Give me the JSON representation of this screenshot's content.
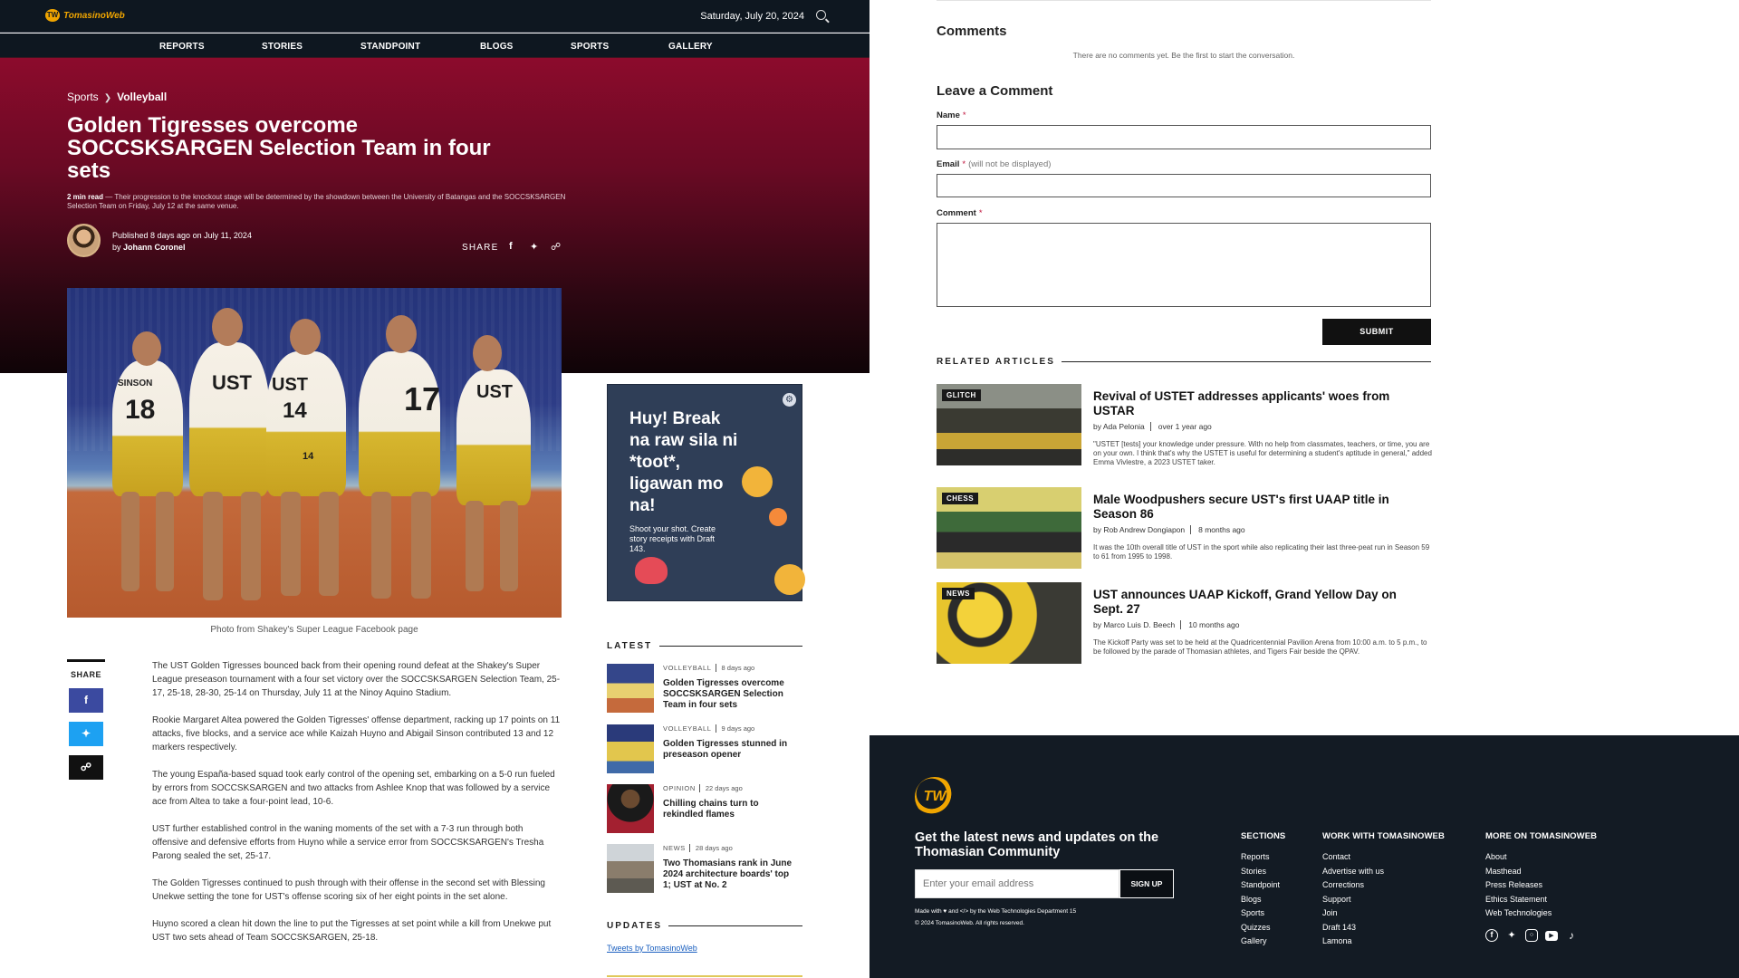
{
  "header": {
    "logo_text": "TomasinoWeb",
    "logo_mark": "TW",
    "date": "Saturday, July 20, 2024"
  },
  "nav": [
    "REPORTS",
    "STORIES",
    "STANDPOINT",
    "BLOGS",
    "SPORTS",
    "GALLERY"
  ],
  "article": {
    "breadcrumb": [
      "Sports",
      "Volleyball"
    ],
    "title": "Golden Tigresses overcome SOCCSKSARGEN Selection Team in four sets",
    "read_time": "2 min read",
    "dek": "— Their progression to the knockout stage will be determined by the showdown between the University of Batangas and the SOCCSKSARGEN Selection Team on Friday, July 12 at the same venue.",
    "published": "Published 8 days ago on July 11, 2024",
    "by": "by",
    "author": "Johann Coronel",
    "share_label": "SHARE",
    "photo_caption": "Photo from Shakey's Super League Facebook page",
    "jersey_numbers": [
      "18",
      "14",
      "17",
      "14"
    ],
    "jersey_text": [
      "SINSON",
      "UST",
      "UST",
      "UST"
    ],
    "paragraphs": [
      "The UST Golden Tigresses bounced back from their opening round defeat at the Shakey's Super League preseason tournament with a four set victory over the SOCCSKSARGEN Selection Team, 25-17, 25-18, 28-30, 25-14 on Thursday, July 11 at the Ninoy Aquino Stadium.",
      "Rookie Margaret Altea powered the Golden Tigresses' offense department, racking up 17 points on 11 attacks, five blocks, and a service ace while Kaizah Huyno and Abigail Sinson contributed 13 and 12 markers respectively.",
      "The young España-based squad took early control of the opening set, embarking on a 5-0 run fueled by errors from SOCCSKSARGEN and two attacks from Ashlee Knop that was followed by a service ace from Altea to take a four-point lead, 10-6.",
      "UST further established control in the waning moments of the set with a 7-3 run through both offensive and defensive efforts from Huyno while a service error from SOCCSKSARGEN's Tresha Parong sealed the set, 25-17.",
      "The Golden Tigresses continued to push through with their offense in the second set with Blessing Unekwe setting the tone for UST's offense scoring six of her eight points in the set alone.",
      "Huyno scored a clean hit down the line to put the Tigresses at set point while a kill from Unekwe put UST two sets ahead of Team SOCCSKSARGEN, 25-18."
    ]
  },
  "ad": {
    "headline": "Huy! Break na raw sila ni *toot*, ligawan mo na!",
    "sub": "Shoot your shot. Create story receipts with Draft 143."
  },
  "sidebar": {
    "latest_label": "LATEST",
    "latest": [
      {
        "cat": "VOLLEYBALL",
        "time": "8 days ago",
        "title": "Golden Tigresses overcome SOCCSKSARGEN Selection Team in four sets"
      },
      {
        "cat": "VOLLEYBALL",
        "time": "9 days ago",
        "title": "Golden Tigresses stunned in preseason opener"
      },
      {
        "cat": "OPINION",
        "time": "22 days ago",
        "title": "Chilling chains turn to rekindled flames"
      },
      {
        "cat": "NEWS",
        "time": "28 days ago",
        "title": "Two Thomasians rank in June 2024 architecture boards' top 1; UST at No. 2"
      }
    ],
    "updates_label": "UPDATES",
    "tweets_link": "Tweets by TomasinoWeb"
  },
  "comments": {
    "heading": "Comments",
    "empty": "There are no comments yet. Be the first to start the conversation.",
    "leave_heading": "Leave a Comment",
    "name_label": "Name",
    "email_label": "Email",
    "email_hint": "(will not be displayed)",
    "comment_label": "Comment",
    "required_mark": "*",
    "submit": "SUBMIT"
  },
  "related": {
    "label": "RELATED ARTICLES",
    "items": [
      {
        "tag": "GLITCH",
        "title": "Revival of USTET addresses applicants' woes from USTAR",
        "author": "by Ada Pelonia",
        "time": "over 1 year ago",
        "excerpt": "\"USTET [tests] your knowledge under pressure. With no help from classmates, teachers, or time, you are on your own. I think that's why the USTET is useful for determining a student's aptitude in general,\" added Emma Vivlestre, a 2023 USTET taker."
      },
      {
        "tag": "CHESS",
        "title": "Male Woodpushers secure UST's first UAAP title in Season 86",
        "author": "by Rob Andrew Dongiapon",
        "time": "8 months ago",
        "excerpt": "It was the 10th overall title of UST in the sport while also replicating their last three-peat run in Season 59 to 61 from 1995 to 1998."
      },
      {
        "tag": "NEWS",
        "title": "UST announces UAAP Kickoff, Grand Yellow Day on Sept. 27",
        "author": "by Marco Luis D. Beech",
        "time": "10 months ago",
        "excerpt": "The Kickoff Party was set to be held at the Quadricentennial Pavilion Arena from 10:00 a.m. to 5 p.m., to be followed by the parade of Thomasian athletes, and Tigers Fair beside the QPAV."
      }
    ]
  },
  "footer": {
    "logo_mark": "TW",
    "tagline": "Get the latest news and updates on the Thomasian Community",
    "email_placeholder": "Enter your email address",
    "signup": "SIGN UP",
    "made_with": "Made with ♥ and </> by the Web Technologies Department 15",
    "copyright": "© 2024 TomasinoWeb. All rights reserved.",
    "columns": [
      {
        "heading": "SECTIONS",
        "links": [
          "Reports",
          "Stories",
          "Standpoint",
          "Blogs",
          "Sports",
          "Quizzes",
          "Gallery"
        ]
      },
      {
        "heading": "WORK WITH TOMASINOWEB",
        "links": [
          "Contact",
          "Advertise with us",
          "Corrections",
          "Support",
          "Join",
          "Draft 143",
          "Lamona"
        ]
      },
      {
        "heading": "MORE ON TOMASINOWEB",
        "links": [
          "About",
          "Masthead",
          "Press Releases",
          "Ethics Statement",
          "Web Technologies"
        ]
      }
    ],
    "social_icons": [
      "facebook-icon",
      "twitter-icon",
      "instagram-icon",
      "youtube-icon",
      "tiktok-icon"
    ]
  },
  "colors": {
    "hero_top": "#8c0b2c",
    "dark": "#0e1720",
    "accent": "#f0a500",
    "facebook": "#3b5998",
    "twitter": "#1da1f2"
  }
}
